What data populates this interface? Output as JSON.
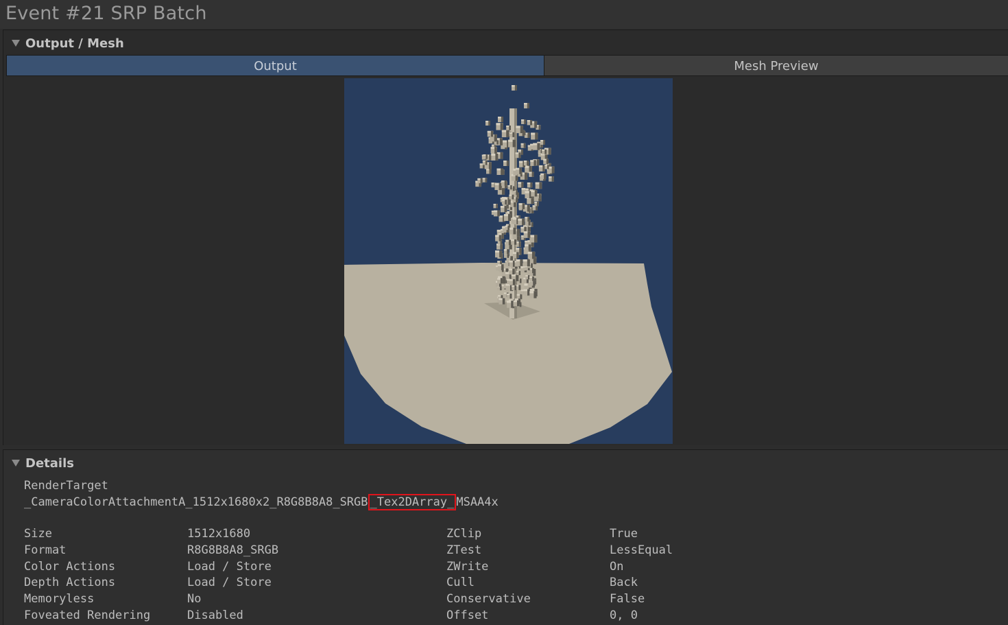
{
  "window": {
    "title": "Event #21 SRP Batch"
  },
  "output_section": {
    "title": "Output / Mesh",
    "tabs": [
      {
        "label": "Output",
        "selected": true
      },
      {
        "label": "Mesh Preview",
        "selected": false
      }
    ],
    "preview": {
      "background_color": "#283d5e",
      "ground_color": "#b8b1a0",
      "object_color": "#aaa493"
    }
  },
  "details_section": {
    "title": "Details",
    "render_target": {
      "label": "RenderTarget",
      "name_prefix": "_CameraColorAttachmentA_1512x1680x2_R8G8B8A8_SRGB",
      "name_highlight": "_Tex2DArray_",
      "name_suffix": "MSAA4x",
      "highlight_color": "#e0141b"
    },
    "properties": [
      {
        "name": "Size",
        "value": "1512x1680",
        "name2": "ZClip",
        "value2": "True"
      },
      {
        "name": "Format",
        "value": "R8G8B8A8_SRGB",
        "name2": "ZTest",
        "value2": "LessEqual"
      },
      {
        "name": "Color Actions",
        "value": "Load / Store",
        "name2": "ZWrite",
        "value2": "On"
      },
      {
        "name": "Depth Actions",
        "value": "Load / Store",
        "name2": "Cull",
        "value2": "Back"
      },
      {
        "name": "Memoryless",
        "value": "No",
        "name2": "Conservative",
        "value2": "False"
      },
      {
        "name": "Foveated Rendering",
        "value": "Disabled",
        "name2": "Offset",
        "value2": "0, 0"
      }
    ]
  }
}
